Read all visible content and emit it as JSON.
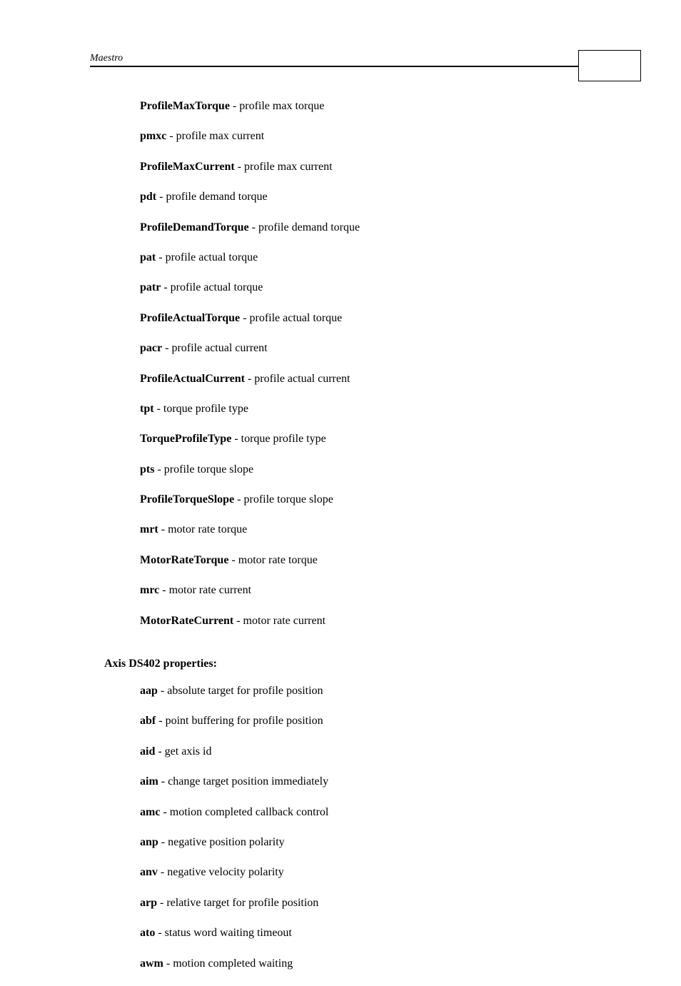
{
  "header": {
    "title": "Maestro"
  },
  "definitions_top": [
    {
      "term": "ProfileMaxTorque",
      "desc": "profile max torque"
    },
    {
      "term": "pmxc",
      "desc": "profile max current"
    },
    {
      "term": "ProfileMaxCurrent",
      "desc": "profile max current"
    },
    {
      "term": "pdt",
      "desc": "profile demand torque"
    },
    {
      "term": "ProfileDemandTorque",
      "desc": "profile demand torque"
    },
    {
      "term": "pat",
      "desc": "profile actual torque"
    },
    {
      "term": "patr",
      "desc": "profile actual torque"
    },
    {
      "term": "ProfileActualTorque",
      "desc": "profile actual torque"
    },
    {
      "term": "pacr",
      "desc": "profile actual current"
    },
    {
      "term": "ProfileActualCurrent",
      "desc": "profile actual current"
    },
    {
      "term": "tpt",
      "desc": "torque profile type"
    },
    {
      "term": "TorqueProfileType",
      "desc": "torque profile type"
    },
    {
      "term": "pts",
      "desc": "profile torque slope"
    },
    {
      "term": "ProfileTorqueSlope",
      "desc": "profile torque slope"
    },
    {
      "term": "mrt",
      "desc": "motor rate torque"
    },
    {
      "term": "MotorRateTorque",
      "desc": "motor rate torque"
    },
    {
      "term": "mrc",
      "desc": "motor rate current"
    },
    {
      "term": "MotorRateCurrent",
      "desc": "motor rate current"
    }
  ],
  "section_title": "Axis DS402 properties:",
  "definitions_bottom": [
    {
      "term": "aap",
      "desc": "absolute target for profile position"
    },
    {
      "term": "abf",
      "desc": "point buffering for profile position"
    },
    {
      "term": "aid",
      "desc": "get axis id"
    },
    {
      "term": "aim",
      "desc": "change target position immediately"
    },
    {
      "term": "amc",
      "desc": "motion completed callback control"
    },
    {
      "term": "anp",
      "desc": "negative position polarity"
    },
    {
      "term": "anv",
      "desc": "negative velocity polarity"
    },
    {
      "term": "arp",
      "desc": "relative target for profile position"
    },
    {
      "term": "ato",
      "desc": "status word waiting timeout"
    },
    {
      "term": "awm",
      "desc": "motion completed waiting"
    }
  ]
}
